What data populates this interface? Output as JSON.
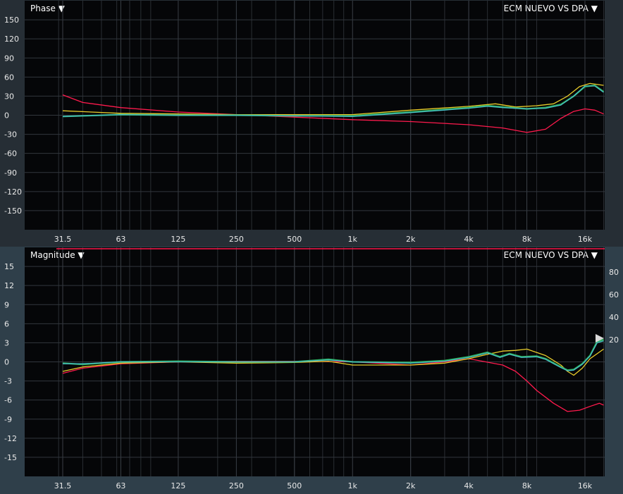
{
  "phase_panel": {
    "title": "Phase ▼",
    "source": "ECM NUEVO VS DPA ▼"
  },
  "magnitude_panel": {
    "title": "Magnitude ▼",
    "source": "ECM NUEVO VS DPA ▼"
  },
  "colors": {
    "red": "#ff1a4d",
    "yellow": "#e8cc2a",
    "green": "#2fae5c",
    "cyan": "#48bfc9",
    "grid": "#2a2e33",
    "axis_text": "#e8e8e8"
  },
  "chart_data": [
    {
      "type": "line",
      "title": "Phase",
      "x_scale": "log",
      "x_ticks": [
        31.5,
        63,
        125,
        250,
        500,
        1000,
        2000,
        4000,
        8000,
        16000
      ],
      "x_tick_labels": [
        "31.5",
        "63",
        "125",
        "250",
        "500",
        "1k",
        "2k",
        "4k",
        "8k",
        "16k"
      ],
      "xlim": [
        20,
        20000
      ],
      "ylim": [
        -180,
        180
      ],
      "y_ticks": [
        150,
        120,
        90,
        60,
        30,
        0,
        -30,
        -60,
        -90,
        -120,
        -150
      ],
      "series": [
        {
          "color": "red",
          "points": [
            [
              31.5,
              32
            ],
            [
              40,
              20
            ],
            [
              63,
              12
            ],
            [
              125,
              5
            ],
            [
              250,
              1
            ],
            [
              500,
              -3
            ],
            [
              1000,
              -7
            ],
            [
              2000,
              -10
            ],
            [
              4000,
              -15
            ],
            [
              6000,
              -20
            ],
            [
              8000,
              -27
            ],
            [
              10000,
              -22
            ],
            [
              12000,
              -5
            ],
            [
              14000,
              6
            ],
            [
              16000,
              10
            ],
            [
              18000,
              8
            ],
            [
              20000,
              2
            ]
          ]
        },
        {
          "color": "yellow",
          "points": [
            [
              31.5,
              7
            ],
            [
              63,
              3
            ],
            [
              125,
              2
            ],
            [
              250,
              1
            ],
            [
              500,
              1
            ],
            [
              1000,
              1
            ],
            [
              2000,
              8
            ],
            [
              4000,
              14
            ],
            [
              5500,
              18
            ],
            [
              7000,
              13
            ],
            [
              9000,
              15
            ],
            [
              11000,
              18
            ],
            [
              13000,
              30
            ],
            [
              15000,
              45
            ],
            [
              17000,
              50
            ],
            [
              20000,
              47
            ]
          ]
        },
        {
          "color": "green",
          "points": [
            [
              31.5,
              -2
            ],
            [
              63,
              1
            ],
            [
              125,
              0
            ],
            [
              250,
              0
            ],
            [
              500,
              -1
            ],
            [
              1000,
              -1
            ],
            [
              2000,
              5
            ],
            [
              4000,
              12
            ],
            [
              5000,
              15
            ],
            [
              6000,
              13
            ],
            [
              8000,
              10
            ],
            [
              10000,
              12
            ],
            [
              12000,
              17
            ],
            [
              14000,
              30
            ],
            [
              16000,
              45
            ],
            [
              18000,
              47
            ],
            [
              20000,
              37
            ]
          ]
        },
        {
          "color": "cyan",
          "points": [
            [
              31.5,
              -2
            ],
            [
              63,
              1
            ],
            [
              125,
              0
            ],
            [
              250,
              0
            ],
            [
              500,
              -1
            ],
            [
              1000,
              -2
            ],
            [
              2000,
              4
            ],
            [
              4000,
              11
            ],
            [
              5000,
              14
            ],
            [
              6000,
              12
            ],
            [
              8000,
              10
            ],
            [
              10000,
              11
            ],
            [
              12000,
              16
            ],
            [
              14000,
              30
            ],
            [
              16000,
              46
            ],
            [
              18000,
              46
            ],
            [
              20000,
              36
            ]
          ]
        }
      ]
    },
    {
      "type": "line",
      "title": "Magnitude",
      "x_scale": "log",
      "x_ticks": [
        31.5,
        63,
        125,
        250,
        500,
        1000,
        2000,
        4000,
        8000,
        16000
      ],
      "x_tick_labels": [
        "31.5",
        "63",
        "125",
        "250",
        "500",
        "1k",
        "2k",
        "4k",
        "8k",
        "16k"
      ],
      "xlim": [
        20,
        20000
      ],
      "ylim": [
        -18,
        18
      ],
      "y_ticks": [
        15,
        12,
        9,
        6,
        3,
        0,
        -3,
        -6,
        -9,
        -12,
        -15
      ],
      "y2_ticks": [
        80,
        60,
        40,
        20
      ],
      "series": [
        {
          "color": "red",
          "points": [
            [
              31.5,
              -1.8
            ],
            [
              40,
              -1
            ],
            [
              63,
              -0.3
            ],
            [
              125,
              0
            ],
            [
              250,
              0.1
            ],
            [
              500,
              0.1
            ],
            [
              1000,
              0
            ],
            [
              2000,
              -0.5
            ],
            [
              3000,
              0
            ],
            [
              4000,
              0.5
            ],
            [
              6000,
              -0.5
            ],
            [
              7000,
              -1.5
            ],
            [
              8000,
              -3
            ],
            [
              9000,
              -4.5
            ],
            [
              11000,
              -6.5
            ],
            [
              13000,
              -7.8
            ],
            [
              15000,
              -7.6
            ],
            [
              17000,
              -7
            ],
            [
              19000,
              -6.5
            ],
            [
              20000,
              -6.8
            ]
          ]
        },
        {
          "color": "yellow",
          "points": [
            [
              31.5,
              -1.5
            ],
            [
              40,
              -0.8
            ],
            [
              63,
              -0.2
            ],
            [
              125,
              0
            ],
            [
              250,
              -0.2
            ],
            [
              500,
              -0.1
            ],
            [
              750,
              0.1
            ],
            [
              1000,
              -0.5
            ],
            [
              2000,
              -0.5
            ],
            [
              3000,
              -0.2
            ],
            [
              4000,
              0.5
            ],
            [
              5000,
              1.2
            ],
            [
              6000,
              1.7
            ],
            [
              7000,
              1.8
            ],
            [
              8000,
              2
            ],
            [
              10000,
              1
            ],
            [
              12000,
              -0.5
            ],
            [
              13000,
              -1.5
            ],
            [
              14000,
              -2.1
            ],
            [
              15500,
              -1
            ],
            [
              17000,
              0.5
            ],
            [
              20000,
              2
            ]
          ]
        },
        {
          "color": "green",
          "points": [
            [
              31.5,
              -0.2
            ],
            [
              40,
              -0.4
            ],
            [
              63,
              0
            ],
            [
              125,
              0.1
            ],
            [
              250,
              0
            ],
            [
              500,
              0
            ],
            [
              750,
              0.4
            ],
            [
              1000,
              0
            ],
            [
              2000,
              -0.1
            ],
            [
              3000,
              0.2
            ],
            [
              4000,
              0.8
            ],
            [
              5000,
              1.5
            ],
            [
              5800,
              0.8
            ],
            [
              6500,
              1.3
            ],
            [
              7500,
              0.8
            ],
            [
              9000,
              0.9
            ],
            [
              10000,
              0.5
            ],
            [
              12000,
              -0.8
            ],
            [
              13000,
              -1.3
            ],
            [
              14000,
              -1.2
            ],
            [
              15500,
              -0.3
            ],
            [
              17000,
              1
            ],
            [
              18500,
              3.2
            ],
            [
              20000,
              3.5
            ]
          ]
        },
        {
          "color": "cyan",
          "points": [
            [
              31.5,
              -0.3
            ],
            [
              40,
              -0.3
            ],
            [
              63,
              0
            ],
            [
              125,
              0
            ],
            [
              250,
              0
            ],
            [
              500,
              0
            ],
            [
              750,
              0.3
            ],
            [
              1000,
              0
            ],
            [
              2000,
              -0.2
            ],
            [
              3000,
              0.1
            ],
            [
              4000,
              0.7
            ],
            [
              5000,
              1.4
            ],
            [
              5800,
              0.7
            ],
            [
              6500,
              1.2
            ],
            [
              7500,
              0.7
            ],
            [
              9000,
              0.8
            ],
            [
              10000,
              0.4
            ],
            [
              12000,
              -0.9
            ],
            [
              13000,
              -1.4
            ],
            [
              14000,
              -1.3
            ],
            [
              15500,
              -0.4
            ],
            [
              17000,
              0.9
            ],
            [
              18500,
              3
            ],
            [
              20000,
              3.3
            ]
          ]
        }
      ]
    }
  ]
}
